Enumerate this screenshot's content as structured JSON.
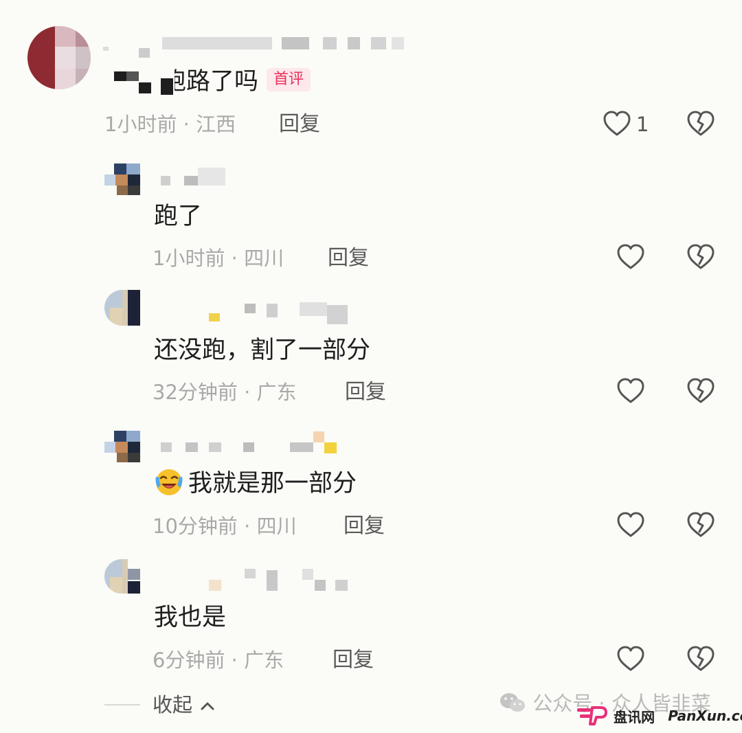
{
  "comments": [
    {
      "text": "跑路了吗",
      "badge": "首评",
      "time": "1小时前",
      "location": "江西",
      "sep": "·",
      "reply_label": "回复",
      "like_count": "1"
    },
    {
      "text": "跑了",
      "time": "1小时前",
      "location": "四川",
      "sep": "·",
      "reply_label": "回复",
      "like_count": ""
    },
    {
      "text": "还没跑，割了一部分",
      "time": "32分钟前",
      "location": "广东",
      "sep": "·",
      "reply_label": "回复",
      "like_count": ""
    },
    {
      "text": "我就是那一部分",
      "emoji": "laughing-crying-emoji",
      "time": "10分钟前",
      "location": "四川",
      "sep": "·",
      "reply_label": "回复",
      "like_count": ""
    },
    {
      "text": "我也是",
      "time": "6分钟前",
      "location": "广东",
      "sep": "·",
      "reply_label": "回复",
      "like_count": ""
    }
  ],
  "footer": {
    "collapse_label": "收起",
    "collapse_icon": "chevron-up-icon"
  },
  "watermarks": {
    "wechat_text": "公众号 · 众人皆韭菜",
    "site_cn": "盘讯网",
    "site_en": "PanXun.cc"
  },
  "icons": {
    "like": "heart-outline-icon",
    "dislike": "broken-heart-icon"
  },
  "colors": {
    "background": "#fbfbf7",
    "badge_text": "#e6325a",
    "badge_bg": "#fde8ec",
    "meta_gray": "#a9a9a9",
    "icon_gray": "#555555",
    "brand_pink": "#e8307a"
  }
}
